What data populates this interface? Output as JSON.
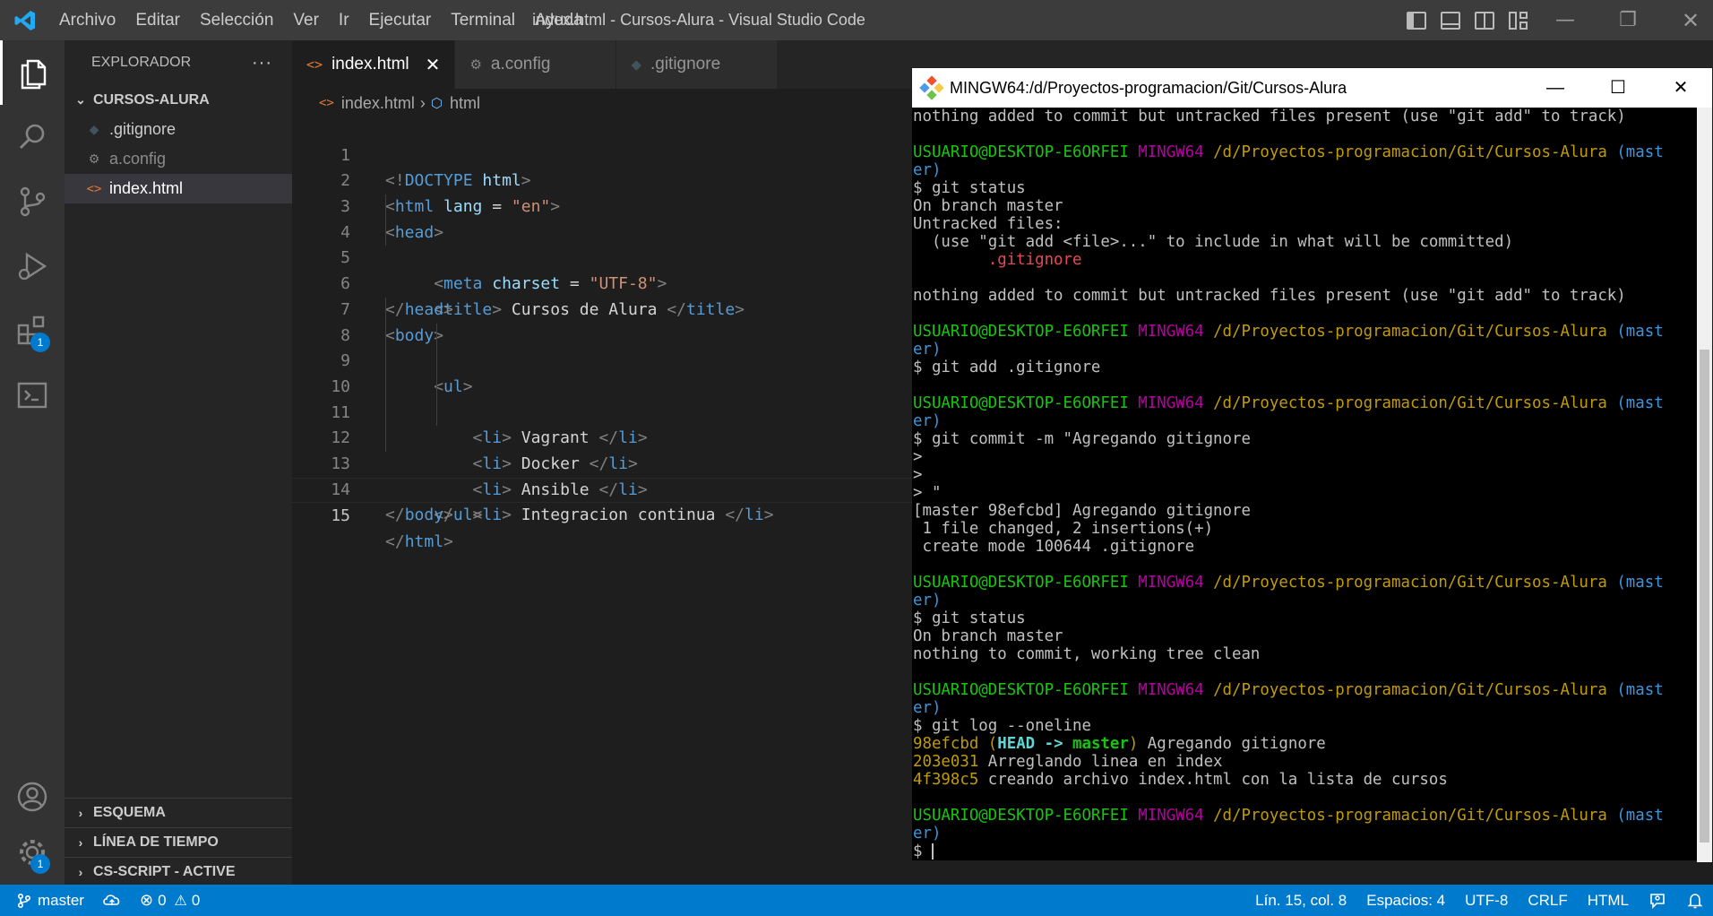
{
  "window": {
    "title": "index.html - Cursos-Alura - Visual Studio Code"
  },
  "menu": [
    "Archivo",
    "Editar",
    "Selección",
    "Ver",
    "Ir",
    "Ejecutar",
    "Terminal",
    "Ayuda"
  ],
  "activity": {
    "extensions_badge": "1",
    "settings_badge": "1"
  },
  "explorer": {
    "title": "EXPLORADOR",
    "more": "···",
    "folder": "CURSOS-ALURA",
    "files": [
      ".gitignore",
      "a.config",
      "index.html"
    ],
    "sections": [
      "ESQUEMA",
      "LÍNEA DE TIEMPO",
      "CS-SCRIPT - ACTIVE"
    ]
  },
  "tabs": [
    {
      "label": "index.html",
      "active": true
    },
    {
      "label": "a.config",
      "active": false
    },
    {
      "label": ".gitignore",
      "active": false
    }
  ],
  "breadcrumb": {
    "file": "index.html",
    "symbol": "html"
  },
  "code": {
    "line_numbers": [
      "1",
      "2",
      "3",
      "4",
      "5",
      "6",
      "7",
      "8",
      "9",
      "10",
      "11",
      "12",
      "13",
      "14",
      "15"
    ],
    "lines": [
      "<!DOCTYPE html>",
      "<html lang = \"en\">",
      "<head>",
      "    <meta charset = \"UTF-8\">",
      "    <title> Cursos de Alura </title>",
      "</head>",
      "<body>",
      "    <ul>",
      "        <li> Vagrant </li>",
      "        <li> Docker </li>",
      "        <li> Ansible </li>",
      "        <li> Integracion continua </li>",
      "    </ul>",
      "</body>",
      "</html>"
    ]
  },
  "terminal": {
    "title": "MINGW64:/d/Proyectos-programacion/Git/Cursos-Alura",
    "prompt_user": "USUARIO@DESKTOP-E6ORFEI",
    "prompt_env": "MINGW64",
    "prompt_path": "/d/Proyectos-programacion/Git/Cursos-Alura",
    "prompt_branch_a": "(mast",
    "prompt_branch_b": "er)",
    "lines": {
      "l0": "nothing added to commit but untracked files present (use \"git add\" to track)",
      "c1": "$ git status",
      "o1a": "On branch master",
      "o1b": "Untracked files:",
      "o1c": "  (use \"git add <file>...\" to include in what will be committed)",
      "o1d": "        .gitignore",
      "o1e": "nothing added to commit but untracked files present (use \"git add\" to track)",
      "c2": "$ git add .gitignore",
      "c3": "$ git commit -m \"Agregando gitignore",
      "c3a": ">",
      "c3b": ">",
      "c3c": "> \"",
      "o3a": "[master 98efcbd] Agregando gitignore",
      "o3b": " 1 file changed, 2 insertions(+)",
      "o3c": " create mode 100644 .gitignore",
      "c4": "$ git status",
      "o4a": "On branch master",
      "o4b": "nothing to commit, working tree clean",
      "c5": "$ git log --oneline",
      "log": [
        {
          "hash": "98efcbd",
          "msg": " Agregando gitignore"
        },
        {
          "hash": "203e031",
          "msg": " Arreglando linea en index"
        },
        {
          "hash": "4f398c5",
          "msg": " creando archivo index.html con la lista de cursos"
        }
      ],
      "log_ref_open": " (",
      "log_ref_head": "HEAD -> ",
      "log_ref_master": "master",
      "log_ref_close": ")",
      "final_prompt": "$ "
    }
  },
  "status": {
    "branch": "master",
    "errors": "0",
    "warnings": "0",
    "position": "Lín. 15, col. 8",
    "spaces": "Espacios: 4",
    "encoding": "UTF-8",
    "eol": "CRLF",
    "language": "HTML"
  },
  "colors": {
    "accent": "#007acc",
    "titlebar": "#3c3c3c",
    "sidebar": "#252526",
    "editor": "#1e1e1e"
  }
}
